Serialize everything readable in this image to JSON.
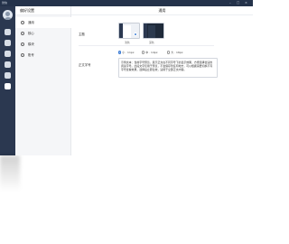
{
  "window": {
    "title": "微信"
  },
  "sidebar": {
    "title": "偏好设置",
    "items": [
      {
        "label": "通用"
      },
      {
        "label": "核心"
      },
      {
        "label": "模块"
      },
      {
        "label": "账号"
      }
    ]
  },
  "main": {
    "title": "通用",
    "theme": {
      "label": "主题",
      "options": [
        {
          "name": "浅色",
          "selected": true
        },
        {
          "name": "深色",
          "selected": false
        }
      ]
    },
    "font_size": {
      "label": "正文字号",
      "options": [
        {
          "label": "小 · 11px",
          "selected": true
        },
        {
          "label": "中 · 14px",
          "selected": false
        },
        {
          "label": "大 · 16px",
          "selected": false
        }
      ],
      "preview": "示例文本：当前字号预览，展示正文在不同字号下的显示效果，方便选择合适的阅读字号。此段文字仅用于预览，不会保存到任何地方，可以根据需要切换不同字号查看效果，选择后立即生效，适用于全部正文内容。"
    }
  },
  "colors": {
    "titlebar": "#24324a",
    "rail": "#2b3850",
    "accent": "#3a7bd5",
    "sidebar_bg": "#f5f6f8"
  }
}
